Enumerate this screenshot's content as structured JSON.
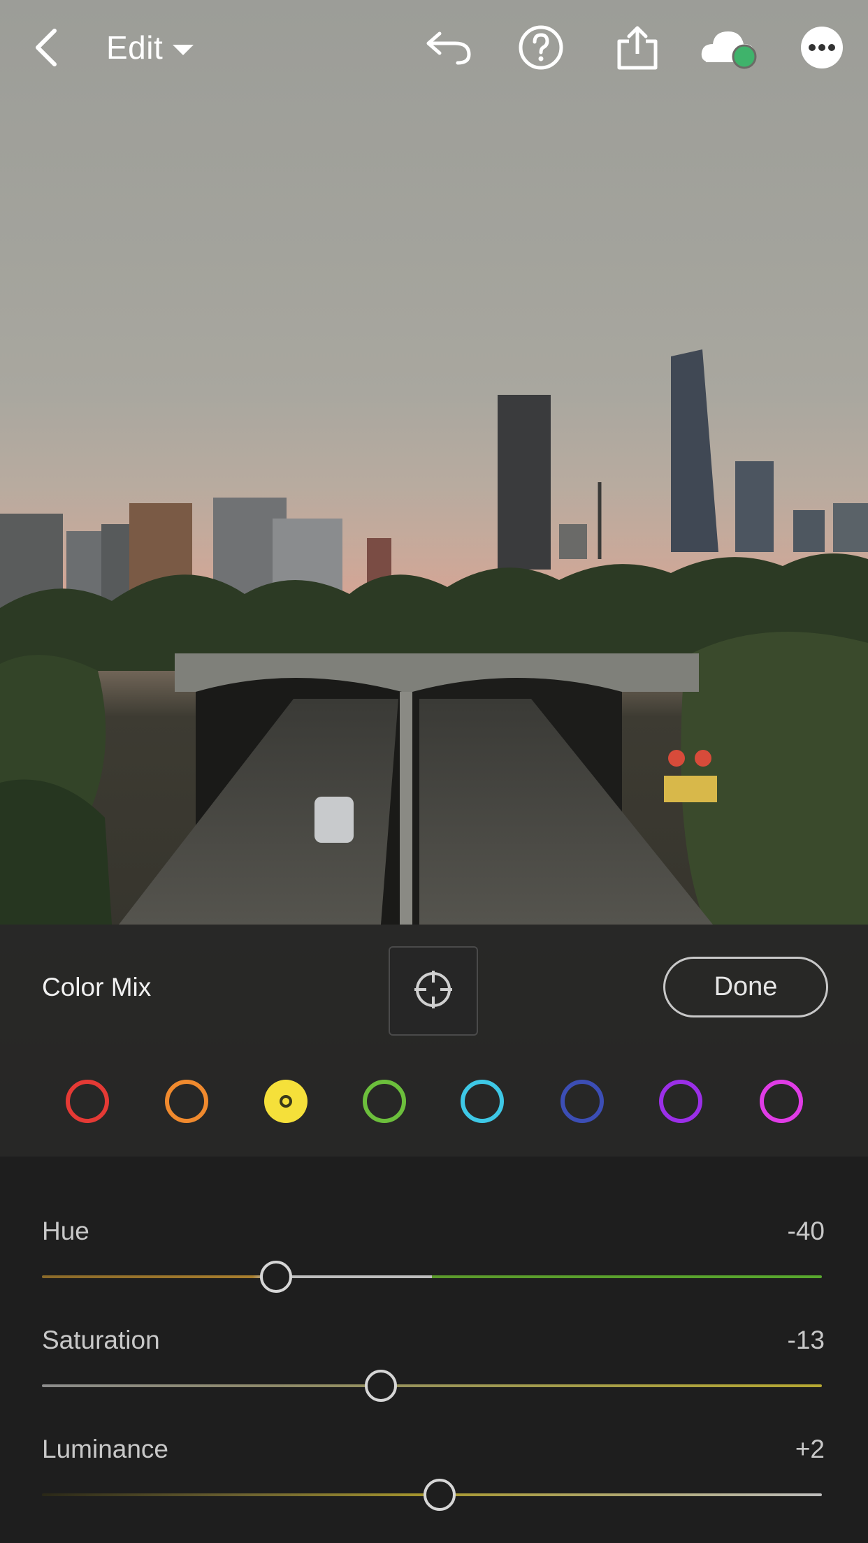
{
  "header": {
    "edit_label": "Edit",
    "icons": [
      "back-icon",
      "undo-icon",
      "help-icon",
      "share-icon",
      "cloud-sync-icon",
      "more-icon"
    ],
    "cloud_status_color": "#3fb36b"
  },
  "color_mix": {
    "title": "Color Mix",
    "target_icon": "target-adjust-icon",
    "done_label": "Done",
    "swatches": [
      {
        "name": "red",
        "color": "#e53a35",
        "selected": false
      },
      {
        "name": "orange",
        "color": "#f08a2e",
        "selected": false
      },
      {
        "name": "yellow",
        "color": "#f5e03a",
        "selected": true
      },
      {
        "name": "green",
        "color": "#6cbf3c",
        "selected": false
      },
      {
        "name": "aqua",
        "color": "#3ec8e6",
        "selected": false
      },
      {
        "name": "blue",
        "color": "#3c4eb5",
        "selected": false
      },
      {
        "name": "purple",
        "color": "#9b2fe8",
        "selected": false
      },
      {
        "name": "magenta",
        "color": "#e03ce6",
        "selected": false
      }
    ]
  },
  "sliders": {
    "hue": {
      "label": "Hue",
      "value": "-40",
      "level": -40
    },
    "saturation": {
      "label": "Saturation",
      "value": "-13",
      "level": -13
    },
    "luminance": {
      "label": "Luminance",
      "value": "+2",
      "level": 2
    }
  }
}
